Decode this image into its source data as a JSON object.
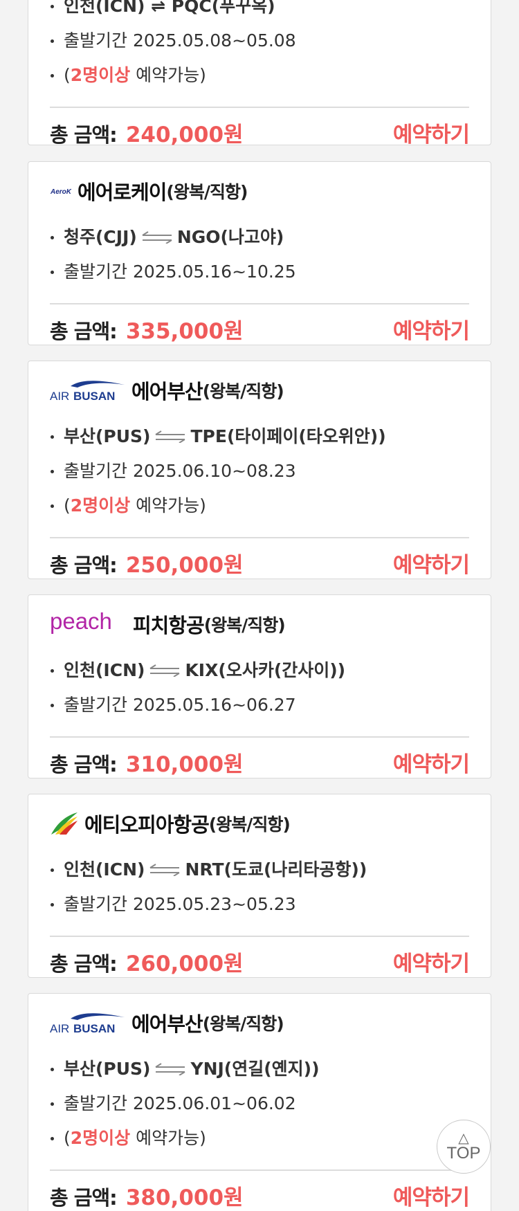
{
  "cards": [
    {
      "route_partial": "인천(ICN) ⇌ PQC(푸꾸옥)",
      "period": "출발기간 2025.05.08~05.08",
      "minpax_open": "(",
      "minpax_hl": "2명이상",
      "minpax_rest": " 예약가능)",
      "total_label": "총 금액:",
      "price": "240,000원",
      "book_label": "예약하기"
    },
    {
      "logo_text": "AeroK",
      "airline": "에어로케이",
      "type": "(왕복/직항)",
      "origin": "청주(CJJ)",
      "dest": "NGO(나고야)",
      "period": "출발기간 2025.05.16~10.25",
      "total_label": "총 금액:",
      "price": "335,000원",
      "book_label": "예약하기"
    },
    {
      "logo_text_1": "AIR",
      "logo_text_2": "BUSAN",
      "airline": "에어부산",
      "type": "(왕복/직항)",
      "origin": "부산(PUS)",
      "dest": "TPE(타이페이(타오위안))",
      "period": "출발기간 2025.06.10~08.23",
      "minpax_open": "(",
      "minpax_hl": "2명이상",
      "minpax_rest": " 예약가능)",
      "total_label": "총 금액:",
      "price": "250,000원",
      "book_label": "예약하기"
    },
    {
      "logo_text": "peach",
      "airline": "피치항공",
      "type": "(왕복/직항)",
      "origin": "인천(ICN)",
      "dest": "KIX(오사카(간사이))",
      "period": "출발기간 2025.05.16~06.27",
      "total_label": "총 금액:",
      "price": "310,000원",
      "book_label": "예약하기"
    },
    {
      "airline": "에티오피아항공",
      "type": "(왕복/직항)",
      "origin": "인천(ICN)",
      "dest": "NRT(도쿄(나리타공항))",
      "period": "출발기간 2025.05.23~05.23",
      "total_label": "총 금액:",
      "price": "260,000원",
      "book_label": "예약하기"
    },
    {
      "logo_text_1": "AIR",
      "logo_text_2": "BUSAN",
      "airline": "에어부산",
      "type": "(왕복/직항)",
      "origin": "부산(PUS)",
      "dest": "YNJ(연길(옌지))",
      "period": "출발기간 2025.06.01~06.02",
      "minpax_open": "(",
      "minpax_hl": "2명이상",
      "minpax_rest": " 예약가능)",
      "total_label": "총 금액:",
      "price": "380,000원",
      "book_label": "예약하기"
    }
  ],
  "top_button": {
    "arrow": "△",
    "label": "TOP"
  },
  "icons": {
    "route_arrows": "swap-arrows-icon",
    "top_arrow": "triangle-up-icon"
  },
  "colors": {
    "accent": "#ef5a5a",
    "card_border": "#d9d9d9",
    "background": "#f3f3f3"
  }
}
